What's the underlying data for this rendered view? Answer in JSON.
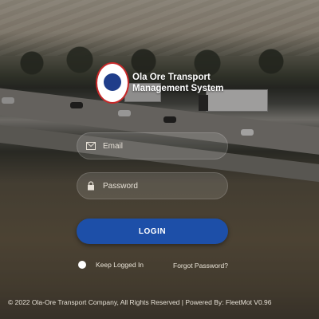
{
  "brand": {
    "line1": "Ola Ore Transport",
    "line2": "Management System"
  },
  "form": {
    "email_placeholder": "Email",
    "password_placeholder": "Password",
    "login_label": "LOGIN",
    "remember_label": "Keep Logged In",
    "forgot_label": "Forgot Password?"
  },
  "footer": {
    "text": "© 2022 Ola-Ore Transport Company, All Rights Reserved | Powered By: FleetMot V0.96"
  },
  "colors": {
    "button": "#1d4fa8",
    "logo_ring": "#c62828"
  }
}
